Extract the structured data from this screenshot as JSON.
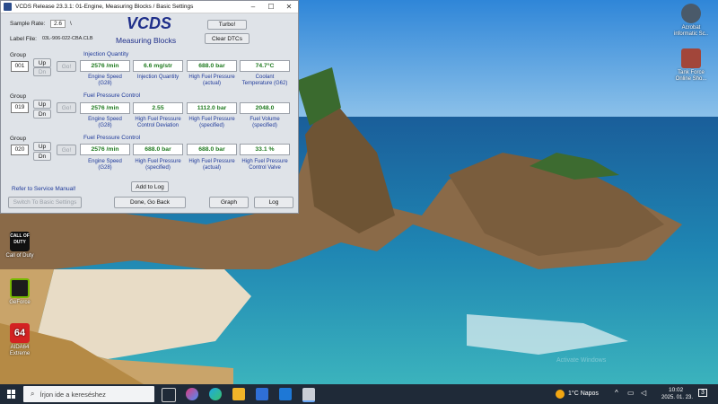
{
  "window": {
    "title": "VCDS Release 23.3.1: 01-Engine,  Measuring Blocks / Basic Settings",
    "app_name": "VCDS",
    "subtitle": "Measuring Blocks",
    "sample_rate_label": "Sample Rate:",
    "sample_rate_value": "2.6",
    "sample_rate_unit": "\\",
    "label_file_label": "Label File:",
    "label_file_value": "03L-906-022-CBA.CLB",
    "turbo_button": "Turbo!",
    "clear_dtcs_button": "Clear DTCs",
    "refer_link": "Refer to Service Manual!",
    "switch_basic_button": "Switch To Basic Settings",
    "add_to_log_button": "Add to Log",
    "done_go_back_button": "Done, Go Back",
    "graph_button": "Graph",
    "log_button": "Log"
  },
  "groups": [
    {
      "label": "Group",
      "number": "001",
      "up": "Up",
      "dn": "Dn",
      "go": "Go!",
      "title": "Injection Quantity",
      "values": [
        "2576 /min",
        "6.6 mg/str",
        "688.0 bar",
        "74.7°C"
      ],
      "captions": [
        "Engine Speed\n(G28)",
        "Injection Quantity",
        "High Fuel Pressure\n(actual)",
        "Coolant\nTemperature (G62)"
      ]
    },
    {
      "label": "Group",
      "number": "019",
      "up": "Up",
      "dn": "Dn",
      "go": "Go!",
      "title": "Fuel Pressure Control",
      "values": [
        "2576 /min",
        "2.55",
        "1112.0 bar",
        "2048.0"
      ],
      "captions": [
        "Engine Speed\n(G28)",
        "High Fuel Pressure\nControl Deviation",
        "High Fuel Pressure\n(specified)",
        "Fuel Volume\n(specified)"
      ]
    },
    {
      "label": "Group",
      "number": "020",
      "up": "Up",
      "dn": "Dn",
      "go": "Go!",
      "title": "Fuel Pressure Control",
      "values": [
        "2576 /min",
        "688.0 bar",
        "688.0 bar",
        "33.1 %"
      ],
      "captions": [
        "Engine Speed\n(G28)",
        "High Fuel Pressure\n(specified)",
        "High Fuel Pressure\n(actual)",
        "High Fuel Pressure\nControl Valve"
      ]
    }
  ],
  "desktop_icons": {
    "top_right_1": "Acrobat\ninformatic Sc..",
    "top_right_2": "Tank Force\nOnline Sho...",
    "left_1": "CALL OF DUTY",
    "left_1_label": "Call of Duty",
    "left_2_label": "GeForce",
    "left_3_label": "AIDA64\nExtreme"
  },
  "watermark": "Activate Windows",
  "taskbar": {
    "search_placeholder": "Írjon ide a kereséshez",
    "weather": "1°C  Napos",
    "time": "10:02",
    "date": "2025. 01. 23.",
    "notification_count": "3"
  }
}
